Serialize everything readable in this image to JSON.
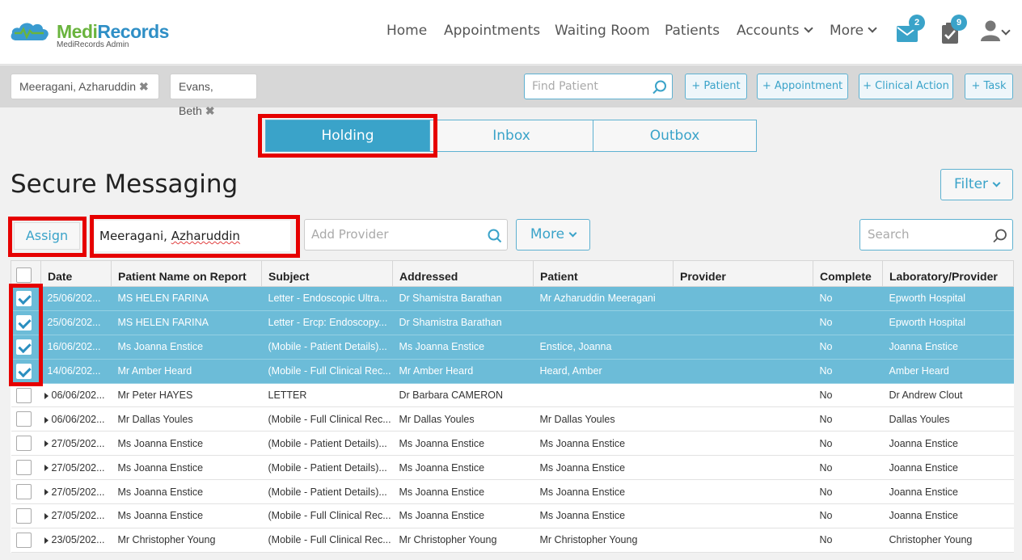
{
  "brand": {
    "name_a": "Medi",
    "name_b": "Records",
    "sub": "MediRecords Admin"
  },
  "nav": {
    "items": [
      "Home",
      "Appointments",
      "Waiting Room",
      "Patients",
      "Accounts",
      "More"
    ],
    "messages_badge": "2",
    "tasks_badge": "9"
  },
  "patient_tabs": [
    "Meeragani, Azharuddin",
    "Evans, Beth"
  ],
  "find_patient": {
    "placeholder": "Find Patient"
  },
  "quick_actions": [
    "+ Patient",
    "+ Appointment",
    "+ Clinical Action",
    "+ Task"
  ],
  "segments": [
    "Holding",
    "Inbox",
    "Outbox"
  ],
  "page_title": "Secure Messaging",
  "filter_label": "Filter",
  "toolbar": {
    "assign_label": "Assign",
    "patient_value_a": "Meeragani, ",
    "patient_value_b": "Azharuddin",
    "provider_placeholder": "Add Provider",
    "more_label": "More",
    "search_placeholder": "Search"
  },
  "table": {
    "columns": [
      "Date",
      "Patient Name on Report",
      "Subject",
      "Addressed",
      "Patient",
      "Provider",
      "Complete",
      "Laboratory/Provider"
    ],
    "rows": [
      {
        "checked": true,
        "expand": false,
        "date": "25/06/202...",
        "report_name": "MS HELEN FARINA",
        "subject": "Letter - Endoscopic Ultra...",
        "addressed": "Dr Shamistra Barathan",
        "patient": "Mr Azharuddin Meeragani",
        "provider": "",
        "complete": "No",
        "lab": "Epworth Hospital"
      },
      {
        "checked": true,
        "expand": false,
        "date": "25/06/202...",
        "report_name": "MS HELEN FARINA",
        "subject": "Letter - Ercp: Endoscopy...",
        "addressed": "Dr Shamistra Barathan",
        "patient": "",
        "provider": "",
        "complete": "No",
        "lab": "Epworth Hospital"
      },
      {
        "checked": true,
        "expand": false,
        "date": "16/06/202...",
        "report_name": "Ms Joanna Enstice",
        "subject": "(Mobile - Patient Details)...",
        "addressed": "Ms Joanna Enstice",
        "patient": "Enstice, Joanna",
        "provider": "",
        "complete": "No",
        "lab": "Joanna Enstice"
      },
      {
        "checked": true,
        "expand": false,
        "date": "14/06/202...",
        "report_name": "Mr Amber Heard",
        "subject": "(Mobile - Full Clinical Rec...",
        "addressed": "Mr Amber Heard",
        "patient": "Heard, Amber",
        "provider": "",
        "complete": "No",
        "lab": "Amber Heard"
      },
      {
        "checked": false,
        "expand": true,
        "date": "06/06/202...",
        "report_name": "Mr Peter HAYES",
        "subject": "LETTER",
        "addressed": "Dr Barbara CAMERON",
        "patient": "",
        "provider": "",
        "complete": "No",
        "lab": "Dr Andrew Clout"
      },
      {
        "checked": false,
        "expand": true,
        "date": "06/06/202...",
        "report_name": "Mr Dallas Youles",
        "subject": "(Mobile - Full Clinical Rec...",
        "addressed": "Mr Dallas Youles",
        "patient": "Mr Dallas Youles",
        "provider": "",
        "complete": "No",
        "lab": "Dallas Youles"
      },
      {
        "checked": false,
        "expand": true,
        "date": "27/05/202...",
        "report_name": "Ms Joanna Enstice",
        "subject": "(Mobile - Patient Details)...",
        "addressed": "Ms Joanna Enstice",
        "patient": "Ms Joanna Enstice",
        "provider": "",
        "complete": "No",
        "lab": "Joanna Enstice"
      },
      {
        "checked": false,
        "expand": true,
        "date": "27/05/202...",
        "report_name": "Ms Joanna Enstice",
        "subject": "(Mobile - Patient Details)...",
        "addressed": "Ms Joanna Enstice",
        "patient": "Ms Joanna Enstice",
        "provider": "",
        "complete": "No",
        "lab": "Joanna Enstice"
      },
      {
        "checked": false,
        "expand": true,
        "date": "27/05/202...",
        "report_name": "Ms Joanna Enstice",
        "subject": "(Mobile - Patient Details)...",
        "addressed": "Ms Joanna Enstice",
        "patient": "Ms Joanna Enstice",
        "provider": "",
        "complete": "No",
        "lab": "Joanna Enstice"
      },
      {
        "checked": false,
        "expand": true,
        "date": "27/05/202...",
        "report_name": "Ms Joanna Enstice",
        "subject": "(Mobile - Full Clinical Rec...",
        "addressed": "Ms Joanna Enstice",
        "patient": "Ms Joanna Enstice",
        "provider": "",
        "complete": "No",
        "lab": "Joanna Enstice"
      },
      {
        "checked": false,
        "expand": true,
        "date": "23/05/202...",
        "report_name": "Mr Christopher Young",
        "subject": "(Mobile - Full Clinical Rec...",
        "addressed": "Mr Christopher Young",
        "patient": "Mr Christopher Young",
        "provider": "",
        "complete": "No",
        "lab": "Christopher Young"
      }
    ]
  },
  "colors": {
    "accent": "#3aa3c9",
    "selected_row": "#6cbcd8",
    "highlight": "#e60000",
    "brand_green": "#6ab43e",
    "brand_blue": "#2f8fc6"
  }
}
